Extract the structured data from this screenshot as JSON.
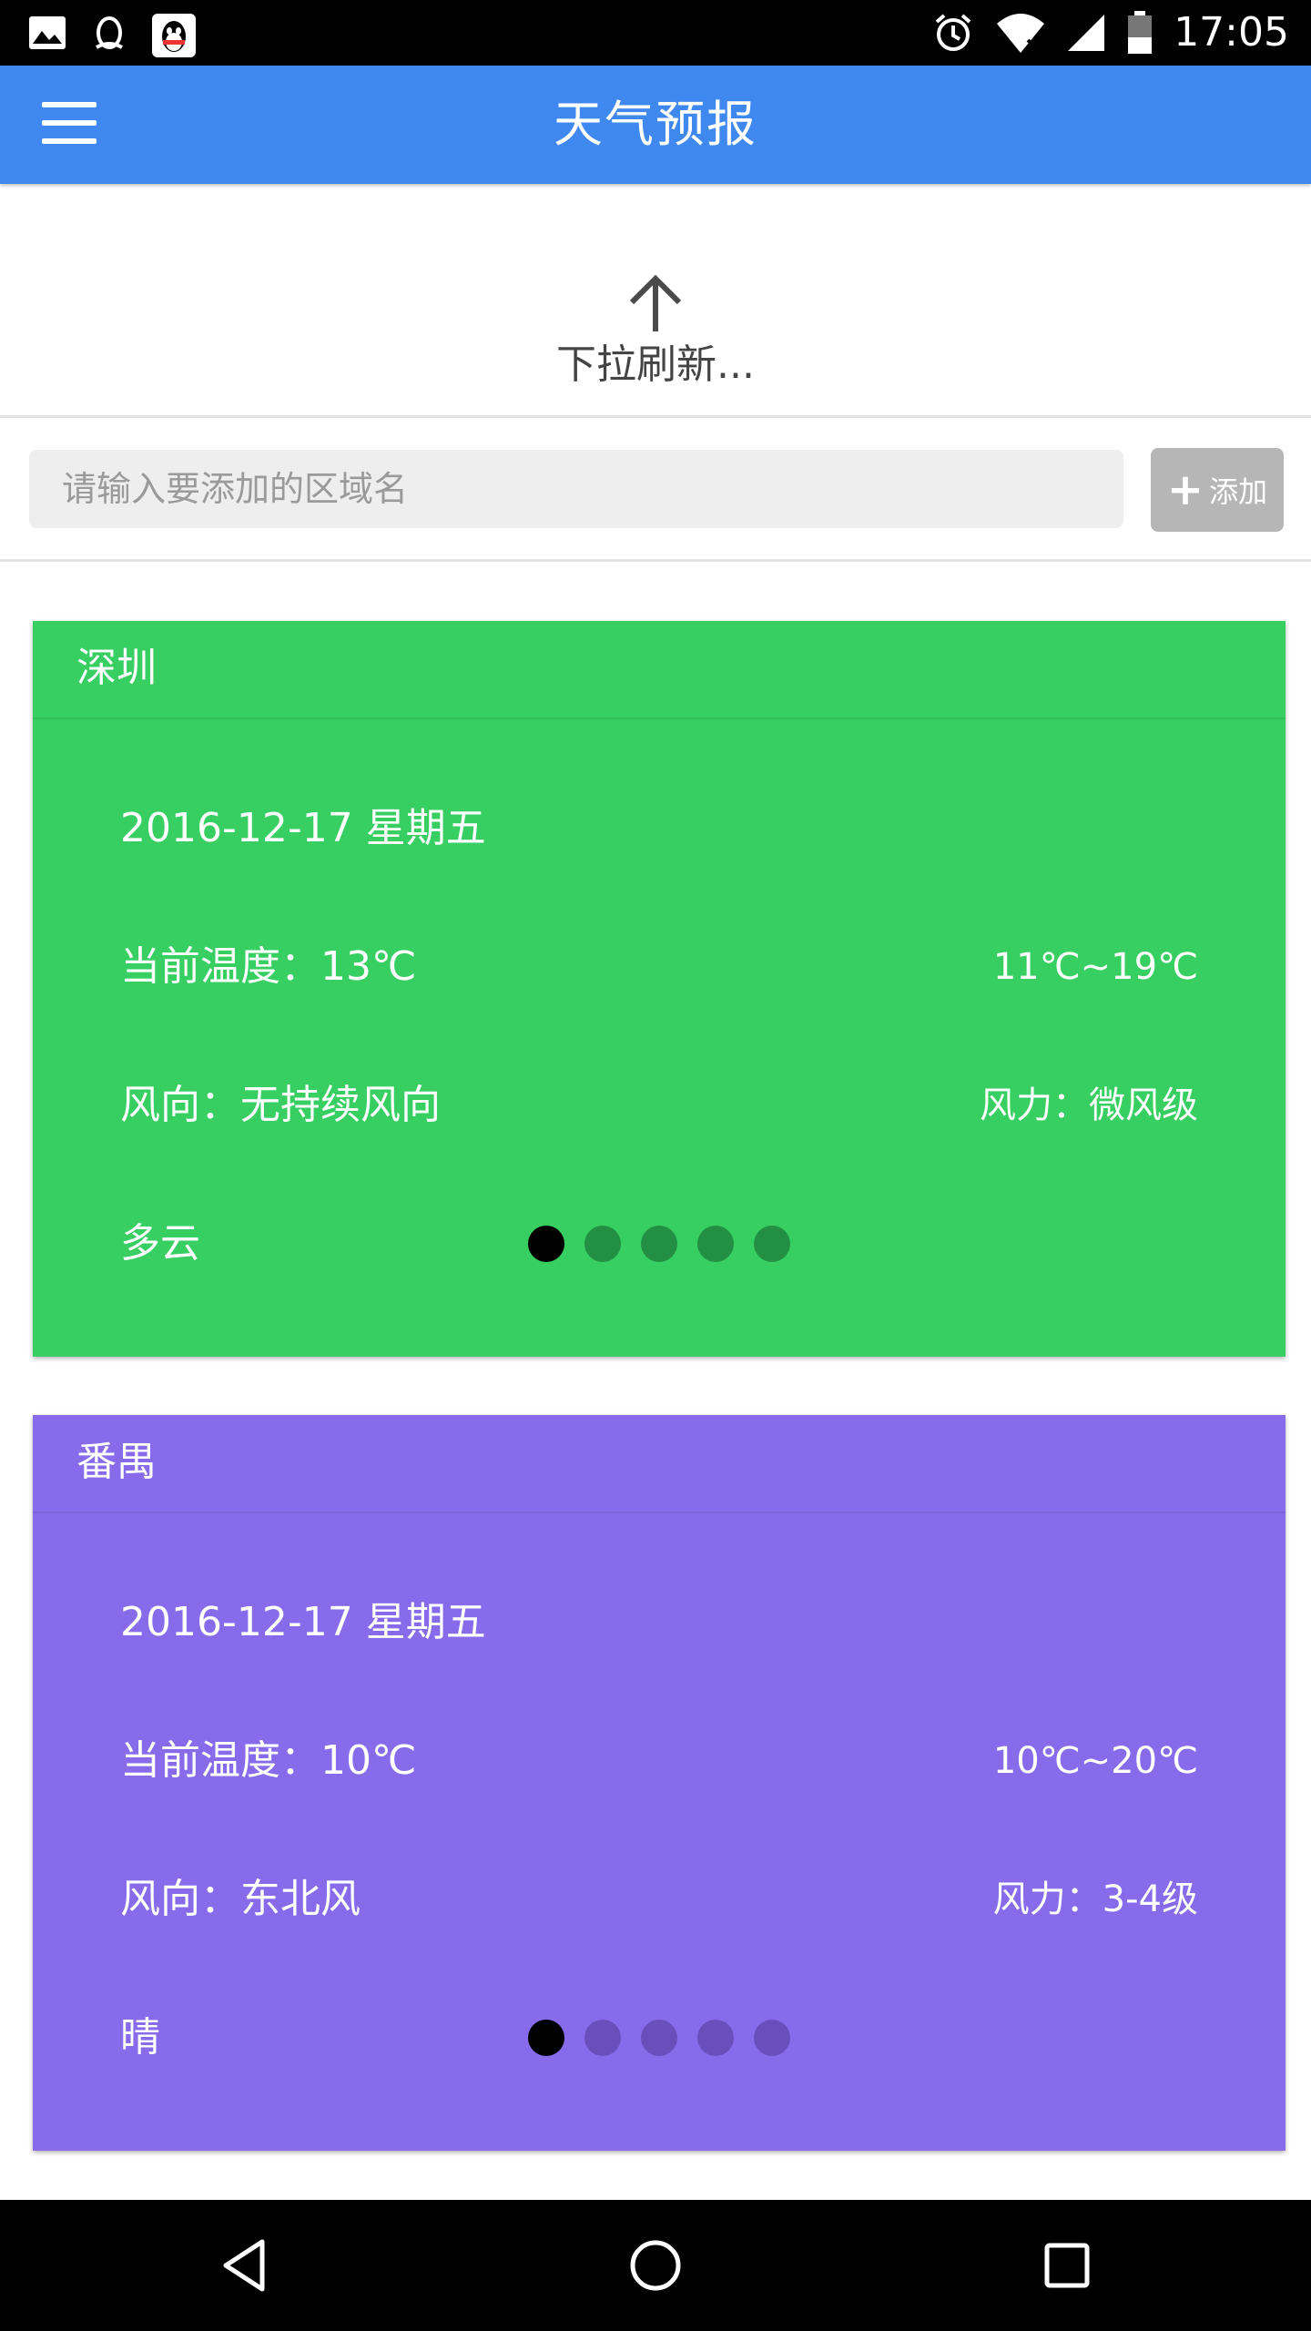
{
  "status_bar": {
    "time": "17:05",
    "left_icons": [
      "image-notification-icon",
      "qq-notification-icon",
      "qq-app-notification-icon"
    ],
    "right_icons": [
      "alarm-icon",
      "wifi-icon",
      "signal-icon",
      "battery-icon"
    ]
  },
  "app_bar": {
    "title": "天气预报",
    "menu_icon": "hamburger-menu-icon",
    "color": "#3E88F0"
  },
  "pull_refresh": {
    "text": "下拉刷新...",
    "icon": "arrow-up-icon"
  },
  "add_area": {
    "placeholder": "请输入要添加的区域名",
    "value": "",
    "button_label": "添加",
    "button_icon": "plus-icon"
  },
  "cards": [
    {
      "city": "深圳",
      "color": "#37CE62",
      "date": "2016-12-17 星期五",
      "current_temp": "当前温度：13℃",
      "temp_range": "11℃~19℃",
      "wind_direction": "风向：无持续风向",
      "wind_force": "风力：微风级",
      "weather": "多云",
      "pager": {
        "total": 5,
        "active": 1,
        "active_color": "#000000",
        "inactive_color": "#238F43"
      }
    },
    {
      "city": "番禺",
      "color": "#886BEA",
      "date": "2016-12-17 星期五",
      "current_temp": "当前温度：10℃",
      "temp_range": "10℃~20℃",
      "wind_direction": "风向：东北风",
      "wind_force": "风力：3-4级",
      "weather": "晴",
      "pager": {
        "total": 5,
        "active": 1,
        "active_color": "#000000",
        "inactive_color": "#6A4FBC"
      }
    }
  ],
  "nav_bar": {
    "buttons": [
      "back-icon",
      "home-icon",
      "recents-icon"
    ]
  }
}
